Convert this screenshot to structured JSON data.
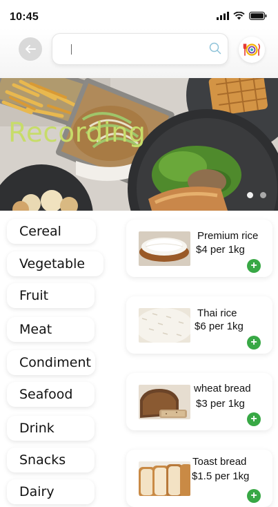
{
  "status_bar": {
    "time": "10:45"
  },
  "search": {
    "placeholder": "",
    "value": ""
  },
  "banner": {
    "title": "Recording",
    "page_dots": 2,
    "active_dot": 0
  },
  "categories": [
    "Cereal",
    "Vegetable",
    "Fruit",
    "Meat",
    "Condiment",
    "Seafood",
    "Drink",
    "Snacks",
    "Dairy"
  ],
  "products": [
    {
      "name": "Premium rice",
      "price": "$4 per 1kg",
      "image": "rice-bowl-photo"
    },
    {
      "name": "Thai rice",
      "price": "$6 per 1kg",
      "image": "thai-rice-photo"
    },
    {
      "name": "wheat bread",
      "price": "$3 per 1kg",
      "image": "wheat-bread-photo"
    },
    {
      "name": "Toast bread",
      "price": "$1.5 per 1kg",
      "image": "toast-bread-photo"
    }
  ],
  "add_label": "+",
  "colors": {
    "accent_green": "#38a845",
    "banner_title": "#c7dc6a",
    "back_button": "#d9d9d9"
  }
}
